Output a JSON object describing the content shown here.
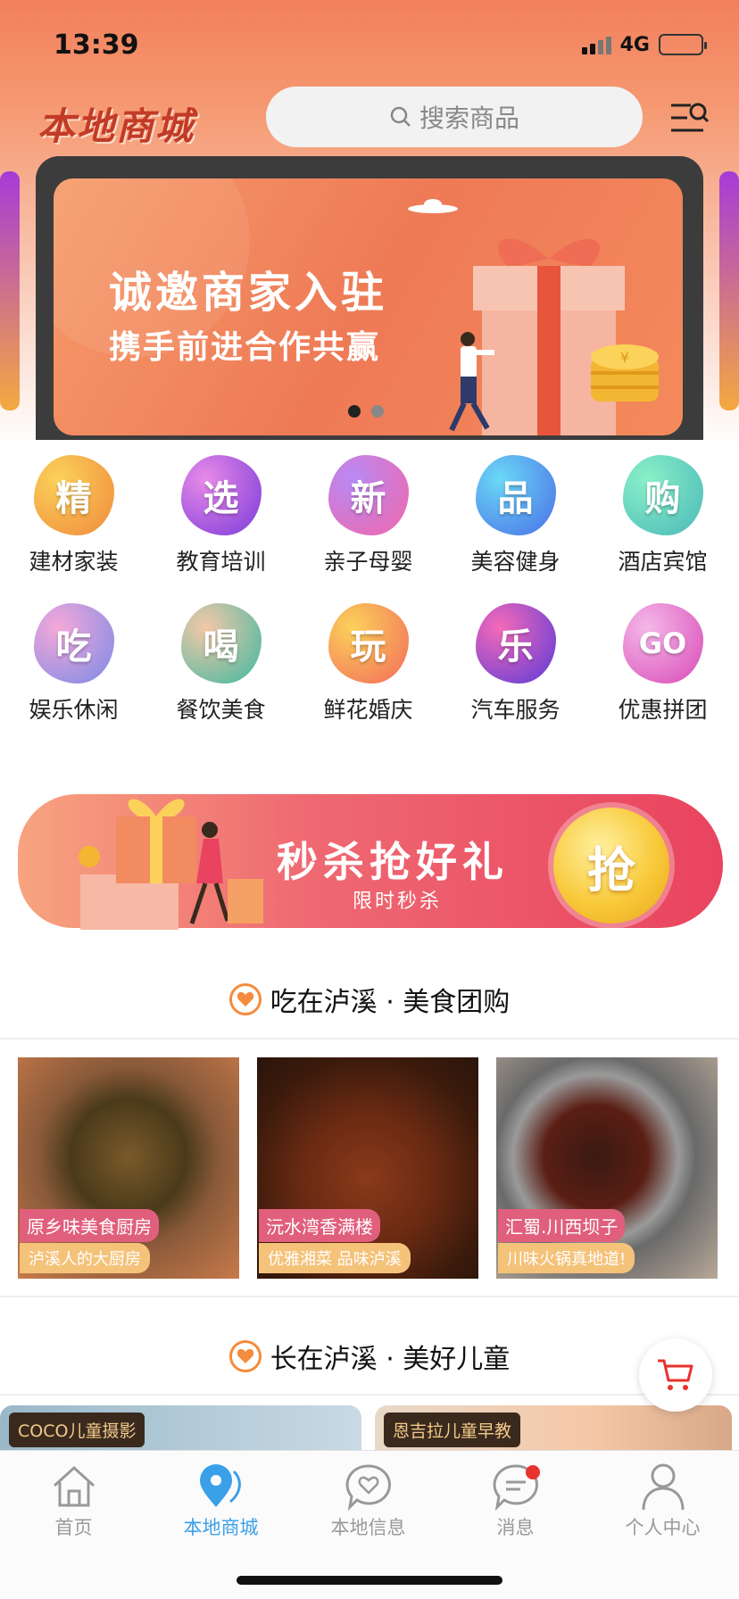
{
  "status": {
    "time": "13:39",
    "network": "4G"
  },
  "header": {
    "logo": "本地商城",
    "search_placeholder": "搜索商品"
  },
  "banner": {
    "title": "诚邀商家入驻",
    "subtitle": "携手前进合作共赢",
    "coin_symbol": "¥",
    "slide_count": 2,
    "active_slide": 1
  },
  "categories": [
    {
      "glyph": "精",
      "label": "建材家装",
      "color": "#f08a3c"
    },
    {
      "glyph": "选",
      "label": "教育培训",
      "color": "#b24fd8"
    },
    {
      "glyph": "新",
      "label": "亲子母婴",
      "color": "#e866b8"
    },
    {
      "glyph": "品",
      "label": "美容健身",
      "color": "#4a8fe8"
    },
    {
      "glyph": "购",
      "label": "酒店宾馆",
      "color": "#4bc4a8"
    },
    {
      "glyph": "吃",
      "label": "娱乐休闲",
      "color": "#8a7ae8"
    },
    {
      "glyph": "喝",
      "label": "餐饮美食",
      "color": "#3db8a0"
    },
    {
      "glyph": "玩",
      "label": "鲜花婚庆",
      "color": "#f5a23c"
    },
    {
      "glyph": "乐",
      "label": "汽车服务",
      "color": "#7a4ad8"
    },
    {
      "glyph": "GO",
      "label": "优惠拼团",
      "color": "#e86acb"
    }
  ],
  "seckill": {
    "title": "秒杀抢好礼",
    "subtitle": "限时秒杀",
    "button": "抢"
  },
  "section_food": {
    "title": "吃在泸溪 · 美食团购"
  },
  "foods": [
    {
      "name": "原乡味美食厨房",
      "slogan": "泸溪人的大厨房"
    },
    {
      "name": "沅水湾香满楼",
      "slogan": "优雅湘菜 品味泸溪"
    },
    {
      "name": "汇蜀.川西坝子",
      "slogan": "川味火锅真地道!"
    }
  ],
  "section_kids": {
    "title": "长在泸溪 · 美好儿童"
  },
  "kids": [
    {
      "name": "COCO儿童摄影"
    },
    {
      "name": "恩吉拉儿童早教"
    }
  ],
  "tabs": [
    {
      "label": "首页",
      "icon": "home-icon"
    },
    {
      "label": "本地商城",
      "icon": "location-icon"
    },
    {
      "label": "本地信息",
      "icon": "heart-chat-icon"
    },
    {
      "label": "消息",
      "icon": "message-icon"
    },
    {
      "label": "个人中心",
      "icon": "person-icon"
    }
  ],
  "colors": {
    "accent": "#3aa0e8",
    "brand": "#c23b26",
    "seckill": "#e9435f"
  }
}
